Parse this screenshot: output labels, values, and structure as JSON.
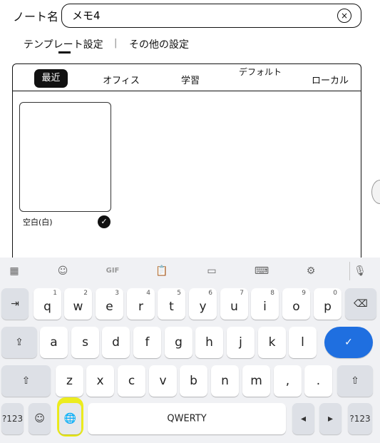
{
  "note": {
    "label": "ノート名",
    "value": "メモ4",
    "clear_icon": "×"
  },
  "settings_links": {
    "template": "テンプレート設定",
    "separator": "|",
    "other": "その他の設定"
  },
  "template_tabs": [
    {
      "label": "最近",
      "active": true
    },
    {
      "label": "オフィス",
      "active": false
    },
    {
      "label": "学習",
      "active": false
    },
    {
      "label": "デフォルト",
      "active": false
    },
    {
      "label": "ローカル",
      "active": false
    }
  ],
  "template_items": [
    {
      "name": "空白(白)",
      "selected": true
    }
  ],
  "keyboard": {
    "toolbar": [
      {
        "icon": "grid-icon",
        "glyph": "▦"
      },
      {
        "icon": "sticker-icon",
        "glyph": "☺"
      },
      {
        "icon": "gif-icon",
        "glyph": "GIF"
      },
      {
        "icon": "clipboard-icon",
        "glyph": "📋"
      },
      {
        "icon": "translate-icon",
        "glyph": "▭"
      },
      {
        "icon": "keyboard-icon",
        "glyph": "⌨"
      },
      {
        "icon": "settings-icon",
        "glyph": "⚙"
      },
      {
        "icon": "mic-icon",
        "glyph": "🎙"
      }
    ],
    "row1": [
      {
        "ch": "q",
        "hint": "1"
      },
      {
        "ch": "w",
        "hint": "2"
      },
      {
        "ch": "e",
        "hint": "3"
      },
      {
        "ch": "r",
        "hint": "4"
      },
      {
        "ch": "t",
        "hint": "5"
      },
      {
        "ch": "y",
        "hint": "6"
      },
      {
        "ch": "u",
        "hint": "7"
      },
      {
        "ch": "i",
        "hint": "8"
      },
      {
        "ch": "o",
        "hint": "9"
      },
      {
        "ch": "p",
        "hint": "0"
      }
    ],
    "row2": [
      "a",
      "s",
      "d",
      "f",
      "g",
      "h",
      "j",
      "k",
      "l"
    ],
    "row3": [
      "z",
      "x",
      "c",
      "v",
      "b",
      "n",
      "m",
      ",",
      "."
    ],
    "tab_glyph": "⇥",
    "backspace_glyph": "⌫",
    "caps_glyph": "⇪",
    "enter_glyph": "✓",
    "shift_glyph": "⇧",
    "symbols_label": "?123",
    "emoji_glyph": "☺",
    "globe_glyph": "🌐",
    "space_label": "QWERTY",
    "left_glyph": "◂",
    "right_glyph": "▸",
    "colors": {
      "enter": "#1f6fe0",
      "highlight": "#ecec1e"
    }
  }
}
